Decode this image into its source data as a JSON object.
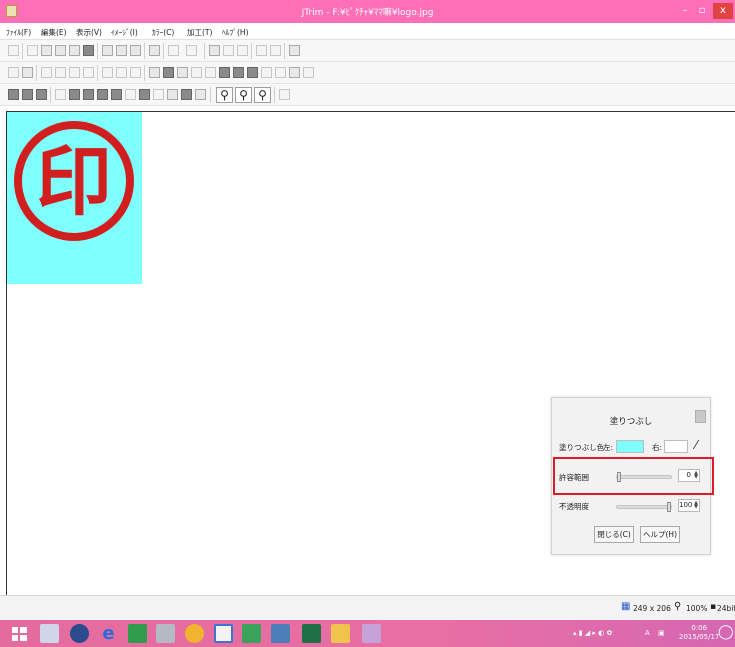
{
  "window": {
    "title": "JTrim - F:¥ﾋﾟｸﾁｬ¥ﾏﾏ嘛¥logo.jpg",
    "minimize": "–",
    "maximize": "▫",
    "close": "x"
  },
  "menu": {
    "items": [
      "ﾌｧｲﾙ(F)",
      "編集(E)",
      "表示(V)",
      "ｲﾒｰｼﾞ(I)",
      "ｶﾗｰ(C)",
      "加工(T)",
      "ﾍﾙﾌﾟ(H)"
    ]
  },
  "canvas": {
    "background_color": "#80ffff",
    "stamp_color": "#d11f1f",
    "stamp_glyph": "印"
  },
  "fill_dialog": {
    "title": "塗りつぶし",
    "fill_color_label": "塗りつぶし色",
    "left_label": "左:",
    "left_color": "#80ffff",
    "right_label": "右:",
    "right_color": "#ffffff",
    "tolerance_label": "許容範囲",
    "tolerance_value": "0",
    "opacity_label": "不透明度",
    "opacity_value": "100",
    "close_button": "閉じる(C)",
    "help_button": "ヘルプ(H)"
  },
  "status": {
    "image_size": "249 x 206",
    "zoom": "100%",
    "color_depth": "24bit"
  },
  "taskbar": {
    "time": "0:06",
    "date": "2015/05/17",
    "tray_text": "A"
  }
}
